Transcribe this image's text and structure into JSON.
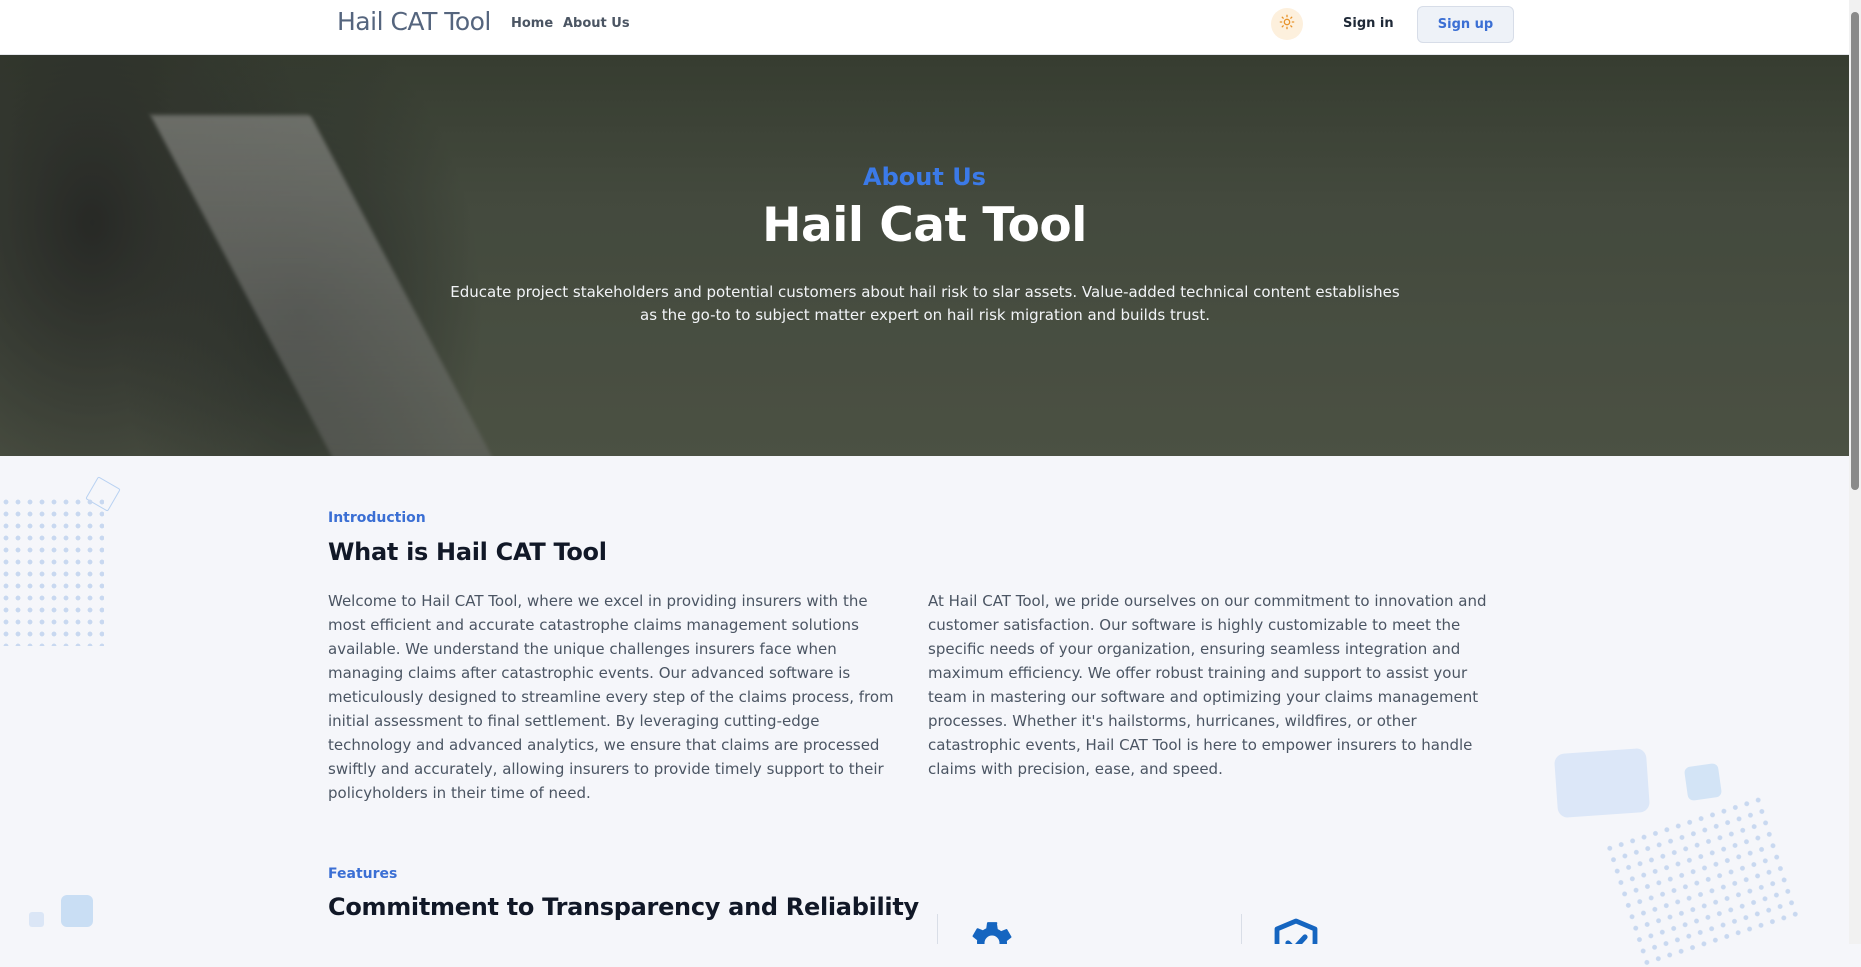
{
  "navbar": {
    "brand": "Hail CAT Tool",
    "links": [
      "Home",
      "About Us"
    ],
    "theme_icon": "sun-icon",
    "signin_label": "Sign in",
    "signup_label": "Sign up"
  },
  "hero": {
    "subtitle": "About Us",
    "title": "Hail Cat Tool",
    "description": "Educate project stakeholders and potential customers about hail risk to slar assets. Value-added technical content establishes as the go-to to subject matter expert on hail risk migration and builds trust."
  },
  "introduction": {
    "eyebrow": "Introduction",
    "title": "What is Hail CAT Tool",
    "paragraph_left": "Welcome to Hail CAT Tool, where we excel in providing insurers with the most efficient and accurate catastrophe claims management solutions available. We understand the unique challenges insurers face when managing claims after catastrophic events. Our advanced software is meticulously designed to streamline every step of the claims process, from initial assessment to final settlement. By leveraging cutting-edge technology and advanced analytics, we ensure that claims are processed swiftly and accurately, allowing insurers to provide timely support to their policyholders in their time of need.",
    "paragraph_right": "At Hail CAT Tool, we pride ourselves on our commitment to innovation and customer satisfaction. Our software is highly customizable to meet the specific needs of your organization, ensuring seamless integration and maximum efficiency. We offer robust training and support to assist your team in mastering our software and optimizing your claims management processes. Whether it's hailstorms, hurricanes, wildfires, or other catastrophic events, Hail CAT Tool is here to empower insurers to handle claims with precision, ease, and speed."
  },
  "features": {
    "eyebrow": "Features",
    "title": "Commitment to Transparency and Reliability",
    "icons": [
      "gear-icon",
      "shield-check-icon"
    ]
  },
  "colors": {
    "accent": "#3b6fd4",
    "icon_blue": "#1565c0",
    "page_bg": "#f5f6fa"
  }
}
